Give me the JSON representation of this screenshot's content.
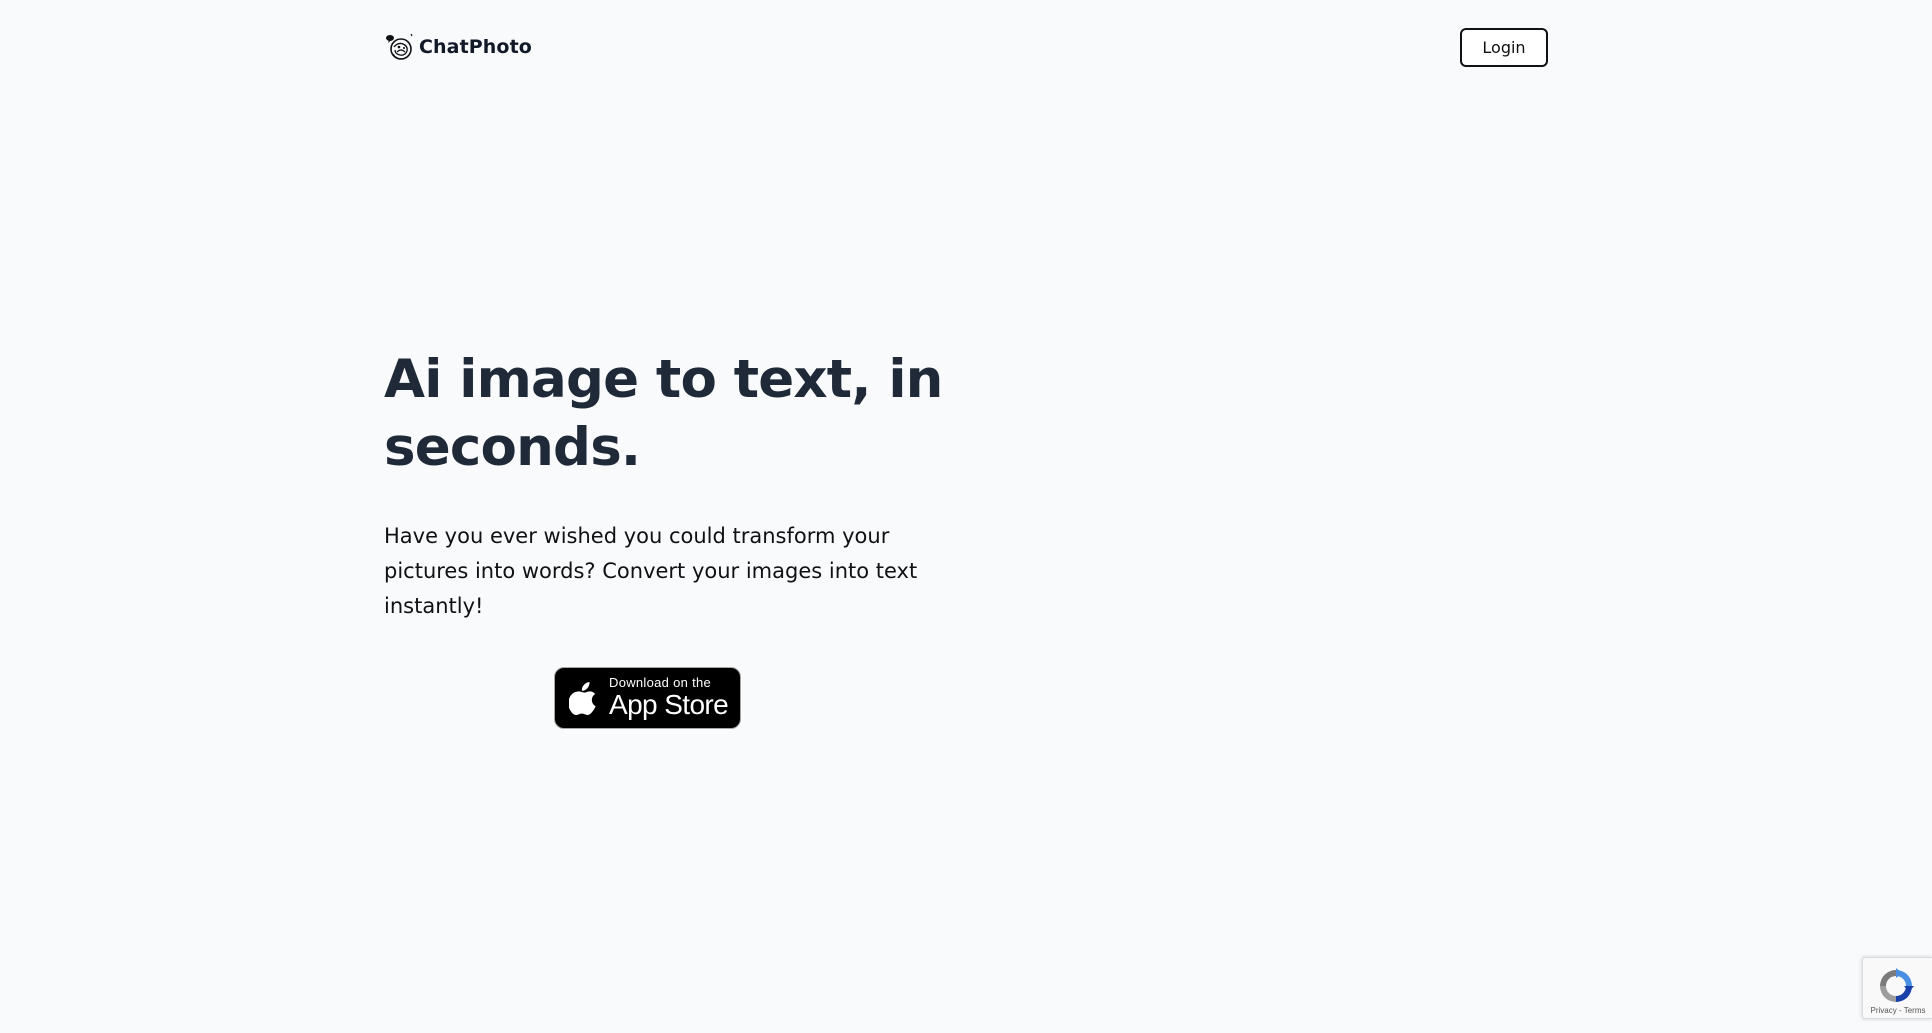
{
  "header": {
    "brand_name": "ChatPhoto",
    "logo_icon": "chatphoto-logo-icon",
    "login_label": "Login"
  },
  "hero": {
    "title_line1": "Ai image to text, in",
    "title_line2": "seconds.",
    "description": "Have you ever wished you could transform your pictures into words? Convert your images into text instantly!"
  },
  "app_store": {
    "small_text": "Download on the",
    "big_text": "App Store",
    "icon": "apple-icon"
  },
  "recaptcha": {
    "icon": "recaptcha-icon",
    "privacy_label": "Privacy",
    "separator": " - ",
    "terms_label": "Terms"
  },
  "colors": {
    "background": "#f8fafc",
    "heading": "#1f2937",
    "button_border": "#111111",
    "app_store_bg": "#000000"
  }
}
